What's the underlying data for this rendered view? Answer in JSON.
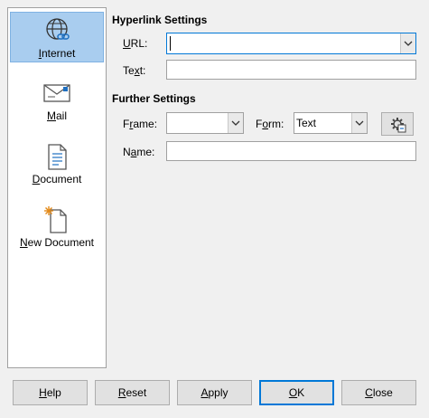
{
  "categories": [
    {
      "label": "Internet",
      "mnemonic": "I",
      "rest": "nternet",
      "icon": "globe-link-icon",
      "selected": true
    },
    {
      "label": "Mail",
      "mnemonic": "M",
      "rest": "ail",
      "icon": "envelope-icon",
      "selected": false
    },
    {
      "label": "Document",
      "mnemonic": "D",
      "rest": "ocument",
      "icon": "document-icon",
      "selected": false
    },
    {
      "label": "New Document",
      "mnemonic": "N",
      "rest": "ew Document",
      "icon": "new-document-icon",
      "selected": false
    }
  ],
  "hyperlink_settings": {
    "title": "Hyperlink Settings",
    "url_label_mn": "U",
    "url_label_rest": "RL:",
    "url_value": "",
    "text_label_pre": "Te",
    "text_label_mn": "x",
    "text_label_rest": "t:",
    "text_value": ""
  },
  "further_settings": {
    "title": "Further Settings",
    "frame_label_pre": "F",
    "frame_label_mn": "r",
    "frame_label_rest": "ame:",
    "frame_value": "",
    "form_label_pre": "F",
    "form_label_mn": "o",
    "form_label_rest": "rm:",
    "form_value": "Text",
    "events_icon": "gear-event-icon",
    "name_label_pre": "N",
    "name_label_mn": "a",
    "name_label_rest": "me:",
    "name_value": ""
  },
  "buttons": {
    "help_mn": "H",
    "help_rest": "elp",
    "reset_mn": "R",
    "reset_rest": "eset",
    "apply_mn": "A",
    "apply_rest": "pply",
    "ok_mn": "O",
    "ok_rest": "K",
    "close_mn": "C",
    "close_rest": "lose"
  },
  "colors": {
    "selected_bg": "#a9cdef",
    "focus_border": "#0078d7",
    "dialog_bg": "#f0f0f0"
  }
}
